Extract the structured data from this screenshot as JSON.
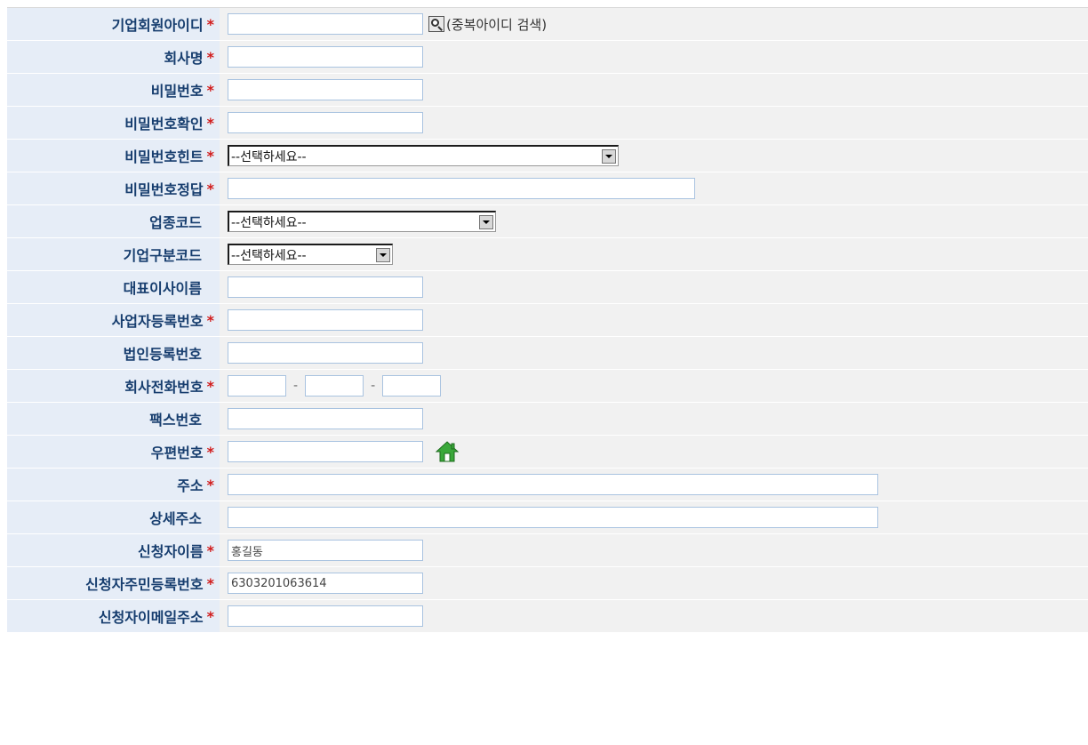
{
  "form": {
    "required_mark": "*",
    "rows": {
      "corp_id": {
        "label": "기업회원아이디",
        "value": "",
        "dup_check_text": "(중복아이디 검색)"
      },
      "company_name": {
        "label": "회사명",
        "value": ""
      },
      "password": {
        "label": "비밀번호",
        "value": ""
      },
      "password_confirm": {
        "label": "비밀번호확인",
        "value": ""
      },
      "password_hint": {
        "label": "비밀번호힌트",
        "selected": "--선택하세요--"
      },
      "password_answer": {
        "label": "비밀번호정답",
        "value": ""
      },
      "industry_code": {
        "label": "업종코드",
        "selected": "--선택하세요--"
      },
      "corp_type_code": {
        "label": "기업구분코드",
        "selected": "--선택하세요--"
      },
      "ceo_name": {
        "label": "대표이사이름",
        "value": ""
      },
      "business_reg_no": {
        "label": "사업자등록번호",
        "value": ""
      },
      "corp_reg_no": {
        "label": "법인등록번호",
        "value": ""
      },
      "company_phone": {
        "label": "회사전화번호",
        "parts": [
          "",
          "",
          ""
        ],
        "separator": "-"
      },
      "fax": {
        "label": "팩스번호",
        "value": ""
      },
      "zipcode": {
        "label": "우편번호",
        "value": ""
      },
      "address": {
        "label": "주소",
        "value": ""
      },
      "address_detail": {
        "label": "상세주소",
        "value": ""
      },
      "applicant_name": {
        "label": "신청자이름",
        "value": "홍길동"
      },
      "applicant_rrn": {
        "label": "신청자주민등록번호",
        "value": "6303201063614"
      },
      "applicant_email": {
        "label": "신청자이메일주소",
        "value": ""
      }
    }
  },
  "colors": {
    "label_bg": "#e6edf7",
    "label_text": "#163d6e",
    "field_bg": "#f1f1f1",
    "required": "#d11a1a",
    "input_border": "#a9c3e0"
  },
  "icons": {
    "search": "search-icon",
    "zip_lookup": "home-icon"
  }
}
